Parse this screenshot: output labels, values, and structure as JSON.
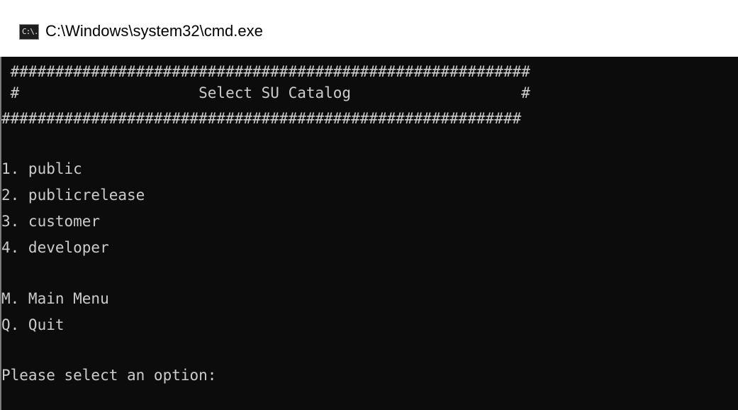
{
  "window": {
    "title": "C:\\Windows\\system32\\cmd.exe",
    "icon": "cmd-icon",
    "icon_text": "C:\\."
  },
  "console": {
    "border_top": " ##########################################################",
    "header_line": " #                    Select SU Catalog                   #",
    "border_bottom": "##########################################################",
    "options": [
      "1. public",
      "2. publicrelease",
      "3. customer",
      "4. developer"
    ],
    "main_menu": "M. Main Menu",
    "quit": "Q. Quit",
    "prompt": "Please select an option:"
  },
  "colors": {
    "background": "#0c0c0c",
    "text": "#cccccc",
    "titlebar": "#ffffff"
  }
}
